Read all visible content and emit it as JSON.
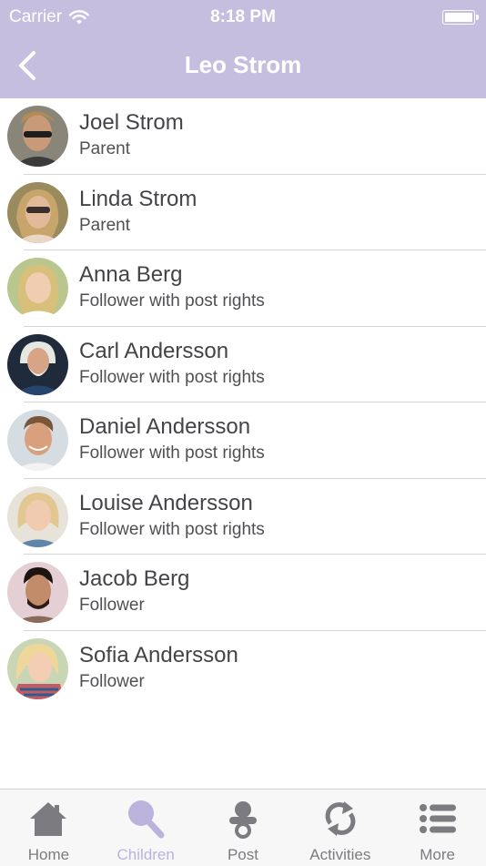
{
  "status_bar": {
    "carrier": "Carrier",
    "time": "8:18 PM"
  },
  "nav": {
    "title": "Leo Strom"
  },
  "members": [
    {
      "name": "Joel Strom",
      "role": "Parent"
    },
    {
      "name": "Linda Strom",
      "role": "Parent"
    },
    {
      "name": "Anna Berg",
      "role": "Follower with post rights"
    },
    {
      "name": "Carl Andersson",
      "role": "Follower with post rights"
    },
    {
      "name": "Daniel Andersson",
      "role": "Follower with post rights"
    },
    {
      "name": "Louise Andersson",
      "role": "Follower with post rights"
    },
    {
      "name": "Jacob Berg",
      "role": "Follower"
    },
    {
      "name": "Sofia Andersson",
      "role": "Follower"
    }
  ],
  "tabs": [
    {
      "label": "Home",
      "icon": "home-icon"
    },
    {
      "label": "Children",
      "icon": "search-icon",
      "active": true
    },
    {
      "label": "Post",
      "icon": "pacifier-icon"
    },
    {
      "label": "Activities",
      "icon": "refresh-icon"
    },
    {
      "label": "More",
      "icon": "list-icon"
    }
  ],
  "colors": {
    "accent": "#c5bedf",
    "active_tab": "#bcb3dd",
    "inactive_tab": "#7c7c80"
  }
}
